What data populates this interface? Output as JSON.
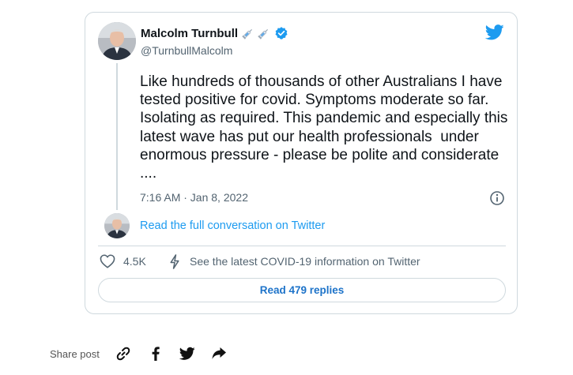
{
  "tweet": {
    "author_name": "Malcolm Turnbull",
    "author_handle": "@TurnbullMalcolm",
    "text": "Like hundreds of thousands of other Australians I have tested positive for covid. Symptoms moderate so far. Isolating as required. This pandemic and especially this latest wave has put our health professionals  under enormous pressure - please be polite and considerate ....",
    "timestamp": "7:16 AM · Jan 8, 2022",
    "read_conversation_label": "Read the full conversation on Twitter",
    "like_count": "4.5K",
    "covid_info_label": "See the latest COVID-19 information on Twitter",
    "replies_button_label": "Read 479 replies"
  },
  "share": {
    "label": "Share post",
    "icons": [
      "link-icon",
      "facebook-icon",
      "twitter-icon",
      "forward-icon"
    ]
  },
  "colors": {
    "twitter_blue": "#1d9bf0",
    "replies_blue": "#1d73c9",
    "secondary_text": "#536471",
    "border": "#cfd9de"
  }
}
